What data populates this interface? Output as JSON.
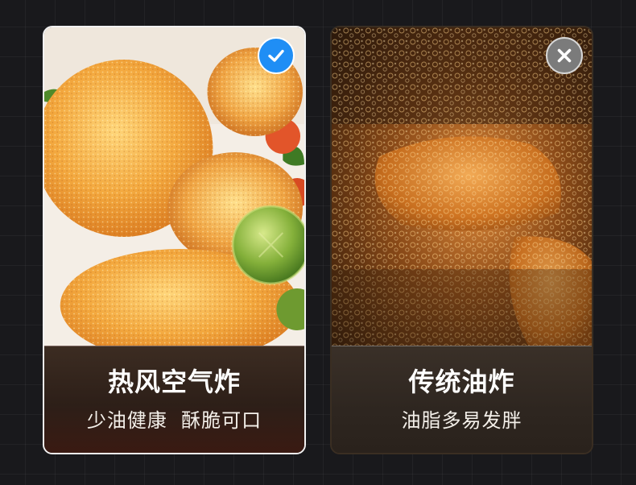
{
  "cards": [
    {
      "title": "热风空气炸",
      "subtitle": "少油健康  酥脆可口",
      "badge_icon": "check-icon",
      "badge_color": "#1f8ef5"
    },
    {
      "title": "传统油炸",
      "subtitle": "油脂多易发胖",
      "badge_icon": "close-icon",
      "badge_color": "#7b7b7b"
    }
  ]
}
